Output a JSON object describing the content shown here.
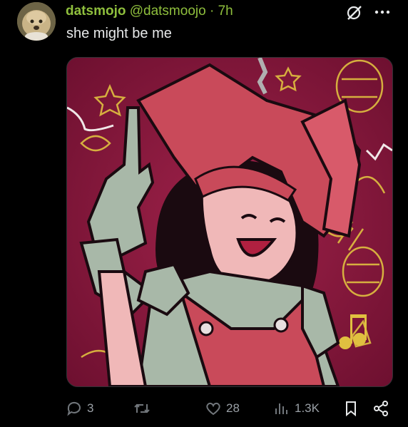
{
  "tweet": {
    "display_name": "datsmojo",
    "handle": "@datsmoojo",
    "separator": "·",
    "time": "7h",
    "text": "she might be me"
  },
  "icons": {
    "grok": "grok-icon",
    "more": "more-icon",
    "reply": "reply-icon",
    "retweet": "retweet-icon",
    "like": "heart-icon",
    "views": "views-icon",
    "bookmark": "bookmark-icon",
    "share": "share-icon"
  },
  "actions": {
    "replies": "3",
    "likes": "28",
    "views": "1.3K"
  },
  "colors": {
    "name_green": "#8fbf3d",
    "muted": "#71767b",
    "media_bg": "#7a1632",
    "character_red": "#c94a5a",
    "doodle_yellow": "#e0c040"
  }
}
